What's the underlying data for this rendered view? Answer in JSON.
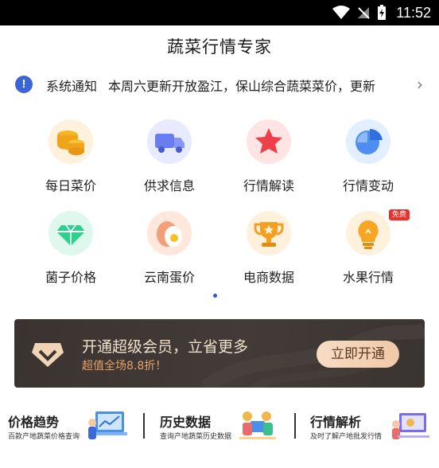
{
  "status_bar": {
    "time": "11:52"
  },
  "header": {
    "title": "蔬菜行情专家"
  },
  "notice": {
    "label": "系统通知",
    "text": "本周六更新开放盈江，保山综合蔬菜菜价，更新"
  },
  "grid_items": [
    {
      "label": "每日菜价",
      "icon": "coins-icon"
    },
    {
      "label": "供求信息",
      "icon": "truck-icon"
    },
    {
      "label": "行情解读",
      "icon": "star-icon"
    },
    {
      "label": "行情变动",
      "icon": "pie-chart-icon"
    },
    {
      "label": "菌子价格",
      "icon": "diamond-icon"
    },
    {
      "label": "云南蛋价",
      "icon": "egg-icon"
    },
    {
      "label": "电商数据",
      "icon": "trophy-icon"
    },
    {
      "label": "水果行情",
      "icon": "lightbulb-icon",
      "badge": "免费"
    }
  ],
  "banner": {
    "title": "开通超级会员，立省更多",
    "subtitle": "超值全场8.8折！",
    "button": "立即开通"
  },
  "bottom_cards": [
    {
      "title": "价格趋势",
      "subtitle": "百款产地蔬菜价格查询"
    },
    {
      "title": "历史数据",
      "subtitle": "查询产地蔬菜历史数据"
    },
    {
      "title": "行情解析",
      "subtitle": "及时了解产地批发行情"
    }
  ],
  "colors": {
    "notice_icon": "#3b64d8",
    "banner_bg": "#3a3330",
    "banner_accent": "#e6a169",
    "page_dot": "#2f58d6"
  }
}
